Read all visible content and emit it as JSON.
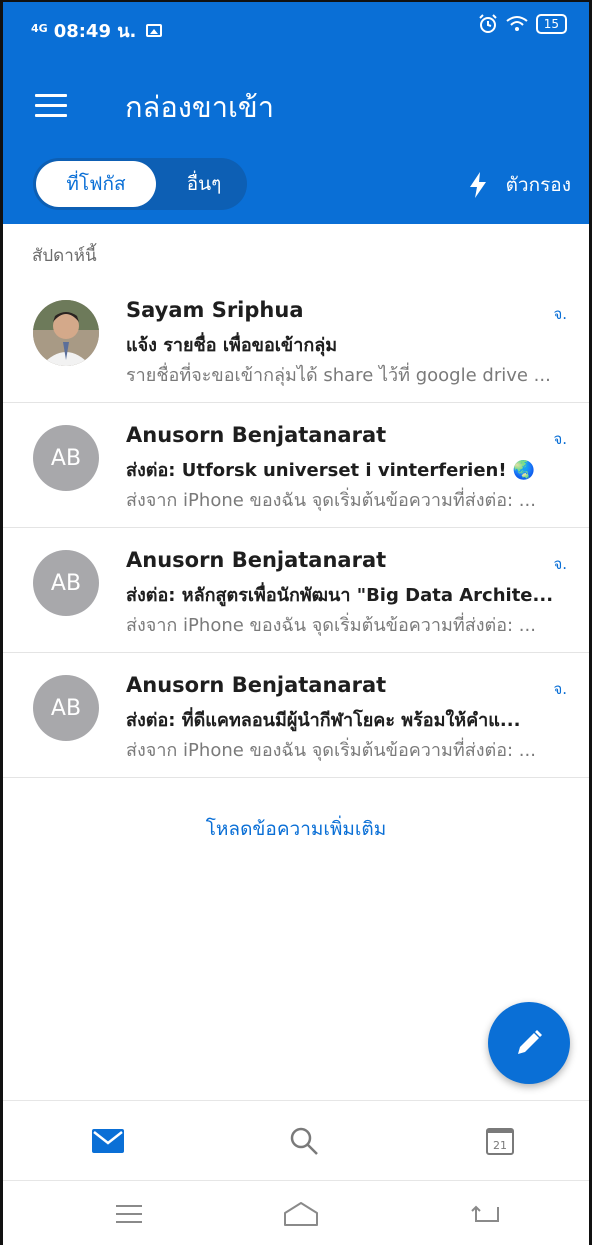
{
  "status_bar": {
    "network": "4G",
    "time": "08:49 น.",
    "battery": "15",
    "icons": [
      "image-icon",
      "alarm-icon",
      "wifi-icon",
      "battery-icon"
    ]
  },
  "header": {
    "title": "กล่องขาเข้า",
    "tabs": [
      {
        "label": "ที่โฟกัส",
        "selected": true
      },
      {
        "label": "อื่นๆ",
        "selected": false
      }
    ],
    "filter_label": "ตัวกรอง"
  },
  "section_label": "สัปดาห์นี้",
  "messages": [
    {
      "sender": "Sayam Sriphua",
      "subject": "แจ้ง รายชื่อ เพื่อขอเข้ากลุ่ม",
      "preview": "รายชื่อที่จะขอเข้ากลุ่มได้ share ไว้ที่ google drive ...",
      "date": "จ.",
      "avatar_initials": ""
    },
    {
      "sender": "Anusorn Benjatanarat",
      "subject": "ส่งต่อ: Utforsk universet i vinterferien! 🌏",
      "preview": "ส่งจาก iPhone ของฉัน จุดเริ่มต้นข้อความที่ส่งต่อ: ...",
      "date": "จ.",
      "avatar_initials": "AB"
    },
    {
      "sender": "Anusorn Benjatanarat",
      "subject": "ส่งต่อ: หลักสูตรเพื่อนักพัฒนา \"Big Data Archite...",
      "preview": "ส่งจาก iPhone ของฉัน จุดเริ่มต้นข้อความที่ส่งต่อ: ...",
      "date": "จ.",
      "avatar_initials": "AB"
    },
    {
      "sender": "Anusorn Benjatanarat",
      "subject": "ส่งต่อ: ที่ดีแคทลอนมีผู้นำกีฬาโยคะ พร้อมให้คำแ...",
      "preview": "ส่งจาก iPhone ของฉัน จุดเริ่มต้นข้อความที่ส่งต่อ: ...",
      "date": "จ.",
      "avatar_initials": "AB"
    }
  ],
  "load_more": "โหลดข้อความเพิ่มเติม",
  "bottom_nav": {
    "items": [
      "mail-icon",
      "search-icon",
      "calendar-icon"
    ],
    "calendar_day": "21",
    "active": "mail"
  },
  "colors": {
    "brand": "#0a6fd6",
    "avatar_gray": "#a8a8ab"
  }
}
